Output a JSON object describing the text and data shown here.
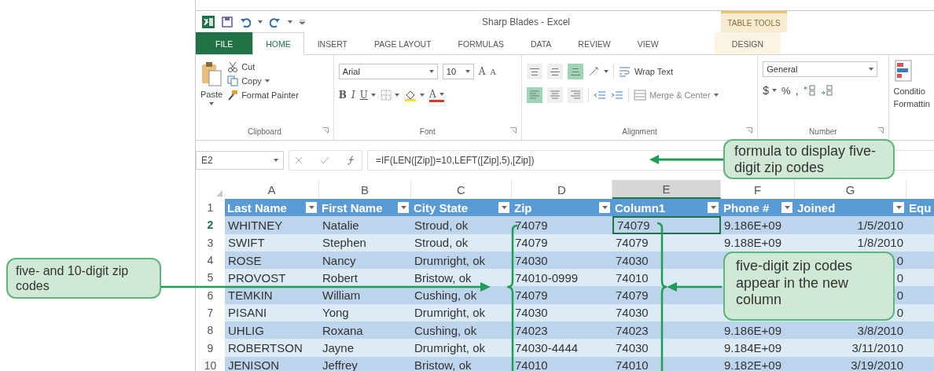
{
  "title_bar": {
    "title": "Sharp Blades - Excel",
    "contextual_group": "TABLE TOOLS"
  },
  "tabs": [
    {
      "label": "FILE",
      "kind": "file",
      "selected": false
    },
    {
      "label": "HOME",
      "kind": "normal",
      "selected": true
    },
    {
      "label": "INSERT",
      "kind": "normal",
      "selected": false
    },
    {
      "label": "PAGE LAYOUT",
      "kind": "normal",
      "selected": false
    },
    {
      "label": "FORMULAS",
      "kind": "normal",
      "selected": false
    },
    {
      "label": "DATA",
      "kind": "normal",
      "selected": false
    },
    {
      "label": "REVIEW",
      "kind": "normal",
      "selected": false
    },
    {
      "label": "VIEW",
      "kind": "normal",
      "selected": false
    },
    {
      "label": "DESIGN",
      "kind": "contextual",
      "selected": false
    }
  ],
  "ribbon": {
    "clipboard": {
      "paste": "Paste",
      "cut": "Cut",
      "copy": "Copy",
      "format_painter": "Format Painter",
      "label": "Clipboard"
    },
    "font": {
      "font_name": "Arial",
      "font_size": "10",
      "grow": "A",
      "shrink": "A",
      "bold": "B",
      "italic": "I",
      "underline": "U",
      "font_color": "A",
      "label": "Font"
    },
    "alignment": {
      "vertical_align": [
        {
          "selected": false
        },
        {
          "selected": false
        },
        {
          "selected": true
        }
      ],
      "horizontal_align": [
        {
          "selected": true
        },
        {
          "selected": false
        },
        {
          "selected": false
        }
      ],
      "wrap_text": "Wrap Text",
      "merge_center": "Merge & Center",
      "label": "Alignment"
    },
    "number": {
      "format": "General",
      "currency": "$",
      "percent": "%",
      "comma": ",",
      "label": "Number"
    },
    "styles": {
      "conditional_formatting": "Conditio",
      "conditional_formatting_line_2": "Formattin"
    }
  },
  "formula_bar": {
    "name_box": "E2",
    "formula": "=IF(LEN([Zip])=10,LEFT([Zip],5),[Zip])"
  },
  "sheet": {
    "columns": [
      {
        "letter": "A",
        "selected": false
      },
      {
        "letter": "B",
        "selected": false
      },
      {
        "letter": "C",
        "selected": false
      },
      {
        "letter": "D",
        "selected": false
      },
      {
        "letter": "E",
        "selected": true
      },
      {
        "letter": "F",
        "selected": false
      },
      {
        "letter": "G",
        "selected": false
      }
    ],
    "header_row": {
      "number": "1",
      "headers": [
        {
          "label": "Last Name",
          "filter": true
        },
        {
          "label": "First Name",
          "filter": true
        },
        {
          "label": "City State",
          "filter": true
        },
        {
          "label": "Zip",
          "filter": true
        },
        {
          "label": "Column1",
          "filter": true
        },
        {
          "label": "Phone #",
          "filter": true
        },
        {
          "label": "Joined",
          "filter": true
        },
        {
          "label": "Equ",
          "filter": false
        }
      ]
    },
    "rows": [
      {
        "number": "2",
        "selected": true,
        "last": "WHITNEY",
        "first": "Natalie",
        "city": "Stroud, ok",
        "zip": "74079",
        "column1": "74079",
        "phone": "9.186E+09",
        "joined": "1/5/2010"
      },
      {
        "number": "3",
        "selected": false,
        "last": "SWIFT",
        "first": "Stephen",
        "city": "Stroud, ok",
        "zip": "74079",
        "column1": "74079",
        "phone": "9.188E+09",
        "joined": "1/8/2010"
      },
      {
        "number": "4",
        "selected": false,
        "last": "ROSE",
        "first": "Nancy",
        "city": "Drumright, ok",
        "zip": "74030",
        "column1": "74030",
        "joined": "0"
      },
      {
        "number": "5",
        "selected": false,
        "last": "PROVOST",
        "first": "Robert",
        "city": "Bristow, ok",
        "zip": "74010-0999",
        "column1": "74010",
        "joined": "0"
      },
      {
        "number": "6",
        "selected": false,
        "last": "TEMKIN",
        "first": "William",
        "city": "Cushing, ok",
        "zip": "74079",
        "column1": "74079",
        "joined": "0"
      },
      {
        "number": "7",
        "selected": false,
        "last": "PISANI",
        "first": "Yong",
        "city": "Drumright, ok",
        "zip": "74030",
        "column1": "74030",
        "joined": "0"
      },
      {
        "number": "8",
        "selected": false,
        "last": "UHLIG",
        "first": "Roxana",
        "city": "Cushing, ok",
        "zip": "74023",
        "column1": "74023",
        "phone": "9.186E+09",
        "joined": "3/8/2010"
      },
      {
        "number": "9",
        "selected": false,
        "last": "ROBERTSON",
        "first": "Jayne",
        "city": "Drumright, ok",
        "zip": "74030-4444",
        "column1": "74030",
        "phone": "9.184E+09",
        "joined": "3/11/2010"
      },
      {
        "number": "10",
        "selected": false,
        "last": "JENISON",
        "first": "Jeffrey",
        "city": "Bristow, ok",
        "zip": "74010",
        "column1": "74010",
        "phone": "9.182E+09",
        "joined": "3/19/2010"
      }
    ]
  },
  "callouts": [
    {
      "text": "formula to display five-digit zip codes"
    },
    {
      "text": "five- and 10-digit zip codes"
    },
    {
      "text": "five-digit zip codes appear in the new column"
    }
  ]
}
